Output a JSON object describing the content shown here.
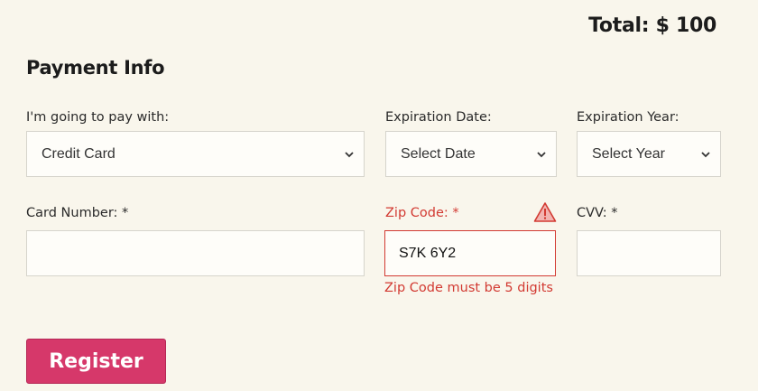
{
  "total": {
    "label": "Total: $ 100"
  },
  "section": {
    "title": "Payment Info"
  },
  "fields": {
    "pay_with": {
      "label": "I'm going to pay with:",
      "value": "Credit Card"
    },
    "exp_date": {
      "label": "Expiration Date:",
      "value": "Select Date"
    },
    "exp_year": {
      "label": "Expiration Year:",
      "value": "Select Year"
    },
    "card_number": {
      "label": "Card Number: *",
      "value": ""
    },
    "zip": {
      "label": "Zip Code: *",
      "value": "S7K 6Y2",
      "error": "Zip Code must be 5 digits"
    },
    "cvv": {
      "label": "CVV: *",
      "value": ""
    }
  },
  "actions": {
    "register_label": "Register"
  },
  "colors": {
    "background": "#f9f6ec",
    "error": "#d23a32",
    "primary_button": "#d6386a"
  },
  "icons": {
    "select_chevron": "chevron-down-icon",
    "zip_warning": "warning-icon"
  }
}
